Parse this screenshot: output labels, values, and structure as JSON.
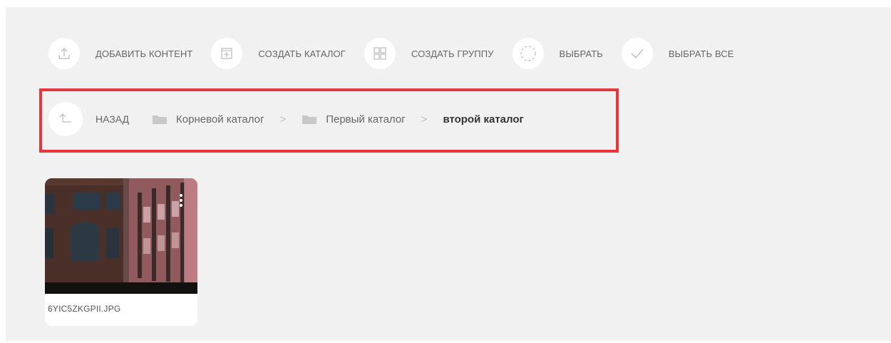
{
  "toolbar": {
    "items": [
      {
        "label": "ДОБАВИТЬ КОНТЕНТ",
        "icon": "upload-icon"
      },
      {
        "label": "СОЗДАТЬ КАТАЛОГ",
        "icon": "add-folder-icon"
      },
      {
        "label": "СОЗДАТЬ ГРУППУ",
        "icon": "grid-icon"
      },
      {
        "label": "ВЫБРАТЬ",
        "icon": "dashed-circle-icon"
      },
      {
        "label": "ВЫБРАТЬ ВСЕ",
        "icon": "checkmark-icon"
      }
    ]
  },
  "breadcrumb": {
    "back_label": "НАЗАД",
    "back_icon": "arrow-up-back-icon",
    "items": [
      {
        "label": "Корневой каталог",
        "icon": "folder-icon"
      },
      {
        "label": "Первый каталог",
        "icon": "folder-icon"
      },
      {
        "label": "второй каталог"
      }
    ],
    "separator": ">"
  },
  "files": [
    {
      "name": "6YIC5ZKGPII.JPG",
      "icon": "more-vertical-icon"
    }
  ],
  "colors": {
    "background": "#f1f1f1",
    "highlight_border": "#e8363a",
    "icon": "#c8c8c8"
  }
}
